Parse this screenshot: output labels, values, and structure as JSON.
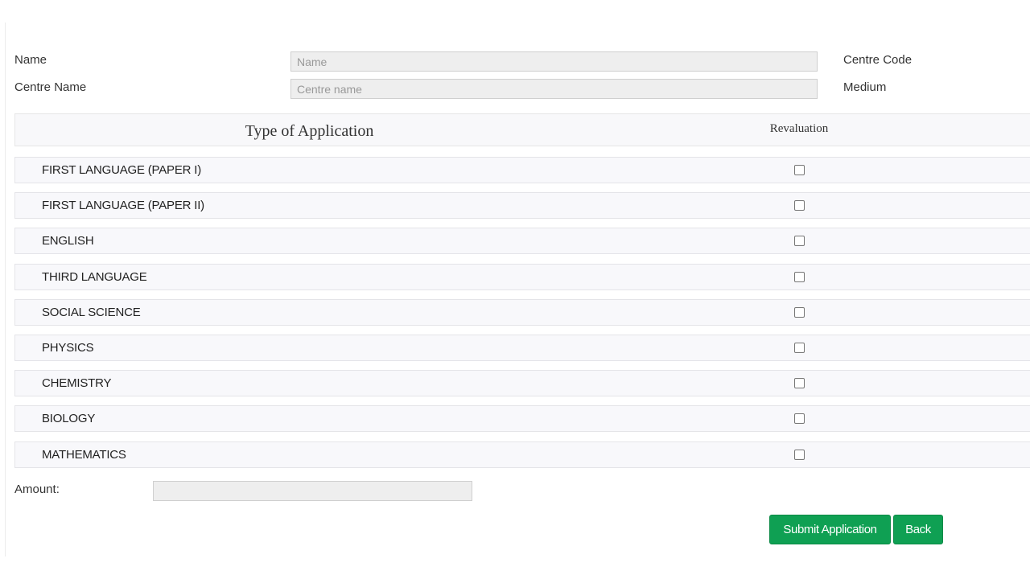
{
  "form": {
    "name_label": "Name",
    "name_placeholder": "Name",
    "centre_name_label": "Centre Name",
    "centre_name_placeholder": "Centre name",
    "centre_code_label": "Centre Code",
    "medium_label": "Medium"
  },
  "table": {
    "header_type": "Type of Application",
    "header_revaluation": "Revaluation",
    "subjects": [
      {
        "label": "FIRST LANGUAGE (PAPER I)",
        "checked": false
      },
      {
        "label": "FIRST LANGUAGE (PAPER II)",
        "checked": false
      },
      {
        "label": "ENGLISH",
        "checked": false
      },
      {
        "label": "THIRD LANGUAGE",
        "checked": false
      },
      {
        "label": "SOCIAL SCIENCE",
        "checked": false
      },
      {
        "label": "PHYSICS",
        "checked": false
      },
      {
        "label": "CHEMISTRY",
        "checked": false
      },
      {
        "label": "BIOLOGY",
        "checked": false
      },
      {
        "label": "MATHEMATICS",
        "checked": false
      }
    ]
  },
  "amount": {
    "label": "Amount:",
    "value": ""
  },
  "actions": {
    "submit_label": "Submit Application",
    "back_label": "Back"
  },
  "colors": {
    "button": "#0fa053",
    "input_bg": "#eeeeee",
    "row_bg": "#f8f8fb"
  }
}
